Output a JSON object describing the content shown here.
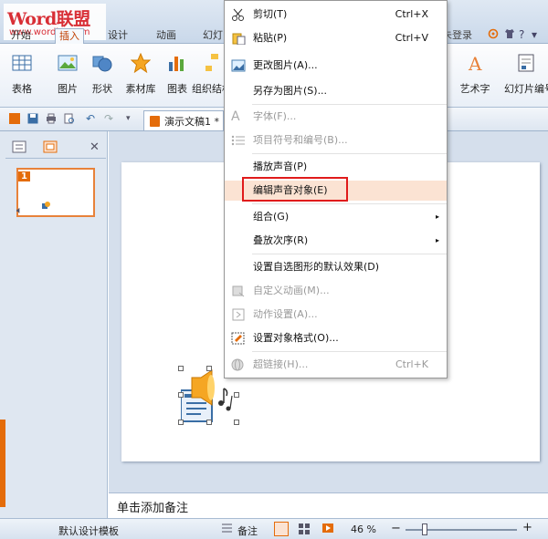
{
  "watermark": {
    "line1": "Word联盟",
    "line2": "www.wordlm.com"
  },
  "ribbon_tabs": [
    "开始",
    "插入",
    "设计",
    "动画",
    "幻灯"
  ],
  "active_tab": "插入",
  "user_area": {
    "login": "未登录"
  },
  "ribbon_buttons": [
    "表格",
    "图片",
    "形状",
    "素材库",
    "图表",
    "组织结构图",
    "艺术字",
    "幻灯片编号"
  ],
  "document": {
    "tab_label": "演示文稿1 *"
  },
  "slide_panel": {
    "slide_number": "1"
  },
  "notes": {
    "placeholder": "单击添加备注"
  },
  "status_bar": {
    "template": "默认设计模板",
    "notes_label": "备注",
    "zoom": "46 %"
  },
  "context_menu": {
    "items": [
      {
        "label": "剪切(T)",
        "shortcut": "Ctrl+X",
        "icon": "scissors-icon",
        "disabled": false
      },
      {
        "label": "粘贴(P)",
        "shortcut": "Ctrl+V",
        "icon": "paste-icon",
        "disabled": false
      },
      {
        "label": "更改图片(A)...",
        "shortcut": "",
        "icon": "change-picture-icon",
        "disabled": false
      },
      {
        "label": "另存为图片(S)...",
        "shortcut": "",
        "icon": "",
        "disabled": false
      },
      {
        "label": "字体(F)...",
        "shortcut": "",
        "icon": "font-icon",
        "disabled": true
      },
      {
        "label": "项目符号和编号(B)...",
        "shortcut": "",
        "icon": "bullets-icon",
        "disabled": true
      },
      {
        "label": "播放声音(P)",
        "shortcut": "",
        "icon": "",
        "disabled": false
      },
      {
        "label": "编辑声音对象(E)",
        "shortcut": "",
        "icon": "",
        "disabled": false,
        "highlighted": true
      },
      {
        "label": "组合(G)",
        "shortcut": "",
        "icon": "",
        "disabled": false,
        "submenu": true
      },
      {
        "label": "叠放次序(R)",
        "shortcut": "",
        "icon": "",
        "disabled": false,
        "submenu": true
      },
      {
        "label": "设置自选图形的默认效果(D)",
        "shortcut": "",
        "icon": "",
        "disabled": false
      },
      {
        "label": "自定义动画(M)...",
        "shortcut": "",
        "icon": "custom-animation-icon",
        "disabled": true
      },
      {
        "label": "动作设置(A)...",
        "shortcut": "",
        "icon": "action-settings-icon",
        "disabled": true
      },
      {
        "label": "设置对象格式(O)...",
        "shortcut": "",
        "icon": "format-object-icon",
        "disabled": false
      },
      {
        "label": "超链接(H)...",
        "shortcut": "Ctrl+K",
        "icon": "hyperlink-icon",
        "disabled": true
      }
    ]
  },
  "colors": {
    "accent_orange": "#e46c0a",
    "highlight_box": "#e01b1b",
    "menu_hover": "#fbe3d3"
  }
}
